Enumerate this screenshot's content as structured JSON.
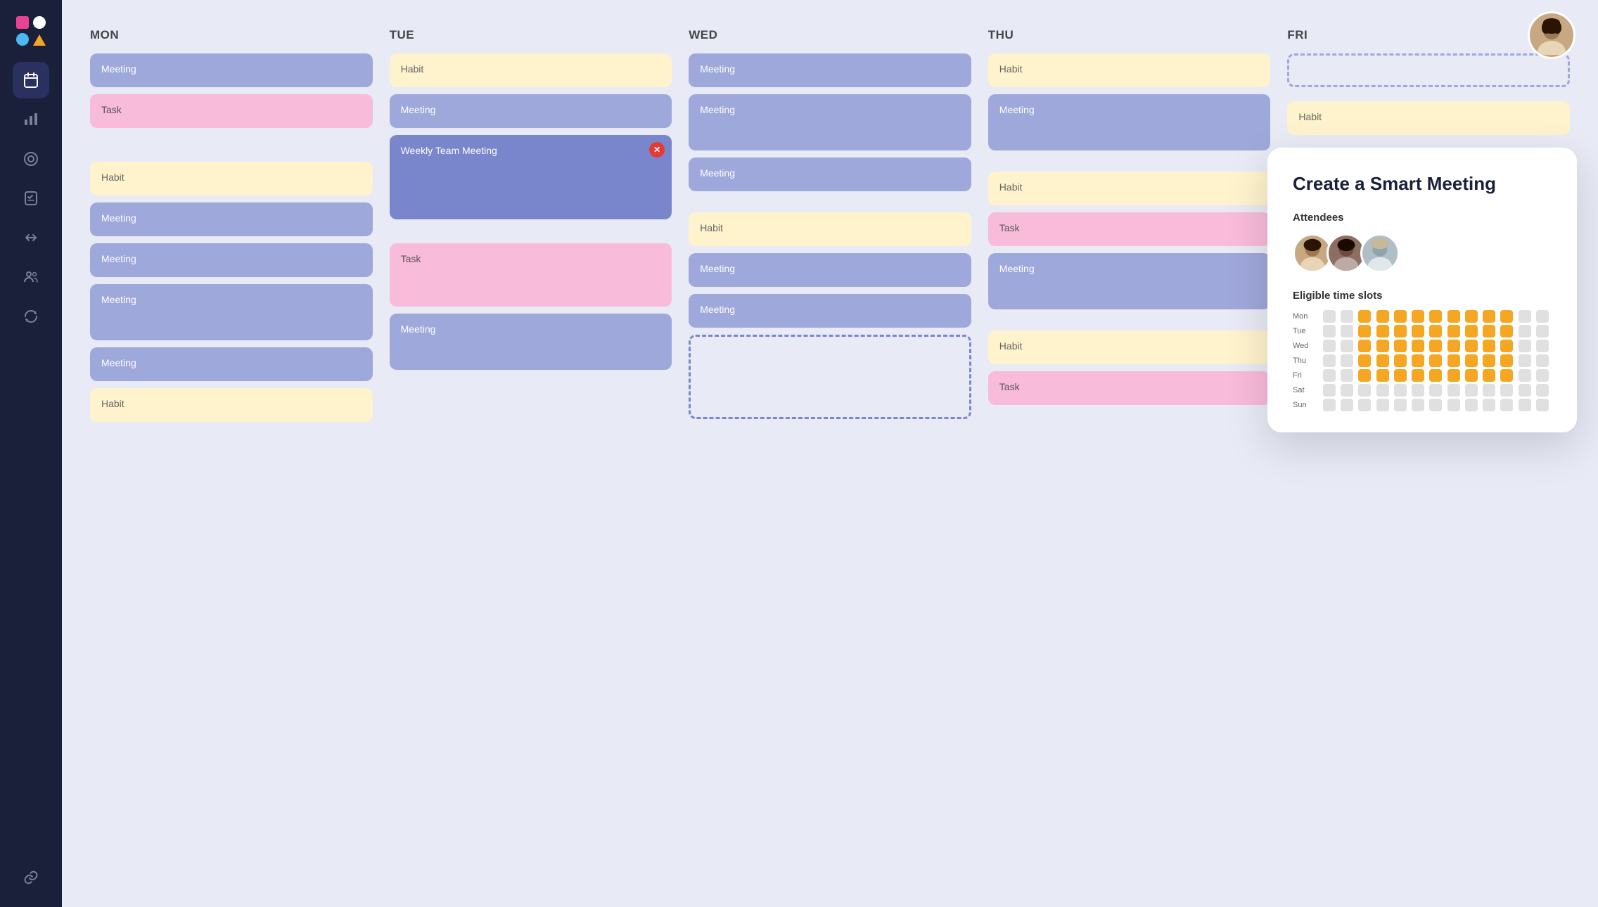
{
  "sidebar": {
    "logo": {
      "sq_color": "#e84393",
      "circle_color": "#fff",
      "dot_color": "#4db6f5",
      "tri_color": "#f5a623"
    },
    "nav_items": [
      {
        "id": "calendar",
        "icon": "📅",
        "active": true
      },
      {
        "id": "analytics",
        "icon": "📊",
        "active": false
      },
      {
        "id": "circle",
        "icon": "◎",
        "active": false
      },
      {
        "id": "tasks",
        "icon": "✅",
        "active": false
      },
      {
        "id": "sync",
        "icon": "⇄",
        "active": false
      },
      {
        "id": "users",
        "icon": "👥",
        "active": false
      },
      {
        "id": "refresh",
        "icon": "🔄",
        "active": false
      }
    ],
    "bottom_items": [
      {
        "id": "link",
        "icon": "🔗"
      }
    ]
  },
  "calendar": {
    "days": [
      "MON",
      "TUE",
      "WED",
      "THU",
      "FRI"
    ],
    "columns": {
      "mon": [
        {
          "type": "meeting",
          "label": "Meeting",
          "tall": false
        },
        {
          "type": "task",
          "label": "Task"
        },
        {
          "type": "spacer"
        },
        {
          "type": "habit",
          "label": "Habit"
        },
        {
          "type": "meeting",
          "label": "Meeting"
        },
        {
          "type": "meeting",
          "label": "Meeting"
        },
        {
          "type": "meeting",
          "label": "Meeting",
          "tall": true
        },
        {
          "type": "meeting",
          "label": "Meeting"
        },
        {
          "type": "habit",
          "label": "Habit"
        }
      ],
      "tue": [
        {
          "type": "habit",
          "label": "Habit"
        },
        {
          "type": "meeting",
          "label": "Meeting"
        },
        {
          "type": "meeting-active",
          "label": "Weekly Team Meeting"
        },
        {
          "type": "spacer"
        },
        {
          "type": "task",
          "label": "Task",
          "tall": true
        },
        {
          "type": "meeting",
          "label": "Meeting",
          "tall": true
        }
      ],
      "wed": [
        {
          "type": "meeting",
          "label": "Meeting"
        },
        {
          "type": "meeting",
          "label": "Meeting",
          "tall": true
        },
        {
          "type": "meeting",
          "label": "Meeting"
        },
        {
          "type": "spacer"
        },
        {
          "type": "habit",
          "label": "Habit"
        },
        {
          "type": "meeting",
          "label": "Meeting"
        },
        {
          "type": "meeting",
          "label": "Meeting"
        },
        {
          "type": "dashed",
          "label": ""
        }
      ],
      "thu": [
        {
          "type": "habit",
          "label": "Habit"
        },
        {
          "type": "meeting",
          "label": "Meeting",
          "tall": true
        },
        {
          "type": "spacer"
        },
        {
          "type": "habit",
          "label": "Habit"
        },
        {
          "type": "task",
          "label": "Task"
        },
        {
          "type": "meeting",
          "label": "Meeting",
          "tall": true
        },
        {
          "type": "spacer"
        },
        {
          "type": "habit",
          "label": "Habit"
        },
        {
          "type": "task",
          "label": "Task"
        }
      ],
      "fri": [
        {
          "type": "dashed-fri",
          "label": ""
        },
        {
          "type": "spacer"
        },
        {
          "type": "spacer"
        },
        {
          "type": "spacer"
        },
        {
          "type": "spacer"
        },
        {
          "type": "spacer"
        },
        {
          "type": "spacer"
        },
        {
          "type": "spacer"
        },
        {
          "type": "habit",
          "label": "Habit"
        }
      ]
    }
  },
  "smart_panel": {
    "title": "Create a Smart Meeting",
    "attendees_label": "Attendees",
    "time_slots_label": "Eligible time slots",
    "days": [
      "Mon",
      "Tue",
      "Wed",
      "Thu",
      "Fri",
      "Sat",
      "Sun"
    ],
    "grid": {
      "Mon": [
        0,
        0,
        1,
        1,
        1,
        1,
        1,
        1,
        1,
        1,
        1,
        0,
        0
      ],
      "Tue": [
        0,
        0,
        1,
        1,
        1,
        1,
        1,
        1,
        1,
        1,
        1,
        0,
        0
      ],
      "Wed": [
        0,
        0,
        1,
        1,
        1,
        1,
        1,
        1,
        1,
        1,
        1,
        0,
        0
      ],
      "Thu": [
        0,
        0,
        1,
        1,
        1,
        1,
        1,
        1,
        1,
        1,
        1,
        0,
        0
      ],
      "Fri": [
        0,
        0,
        1,
        1,
        1,
        1,
        1,
        1,
        1,
        1,
        1,
        0,
        0
      ],
      "Sat": [
        0,
        0,
        0,
        0,
        0,
        0,
        0,
        0,
        0,
        0,
        0,
        0,
        0
      ],
      "Sun": [
        0,
        0,
        0,
        0,
        0,
        0,
        0,
        0,
        0,
        0,
        0,
        0,
        0
      ]
    }
  }
}
